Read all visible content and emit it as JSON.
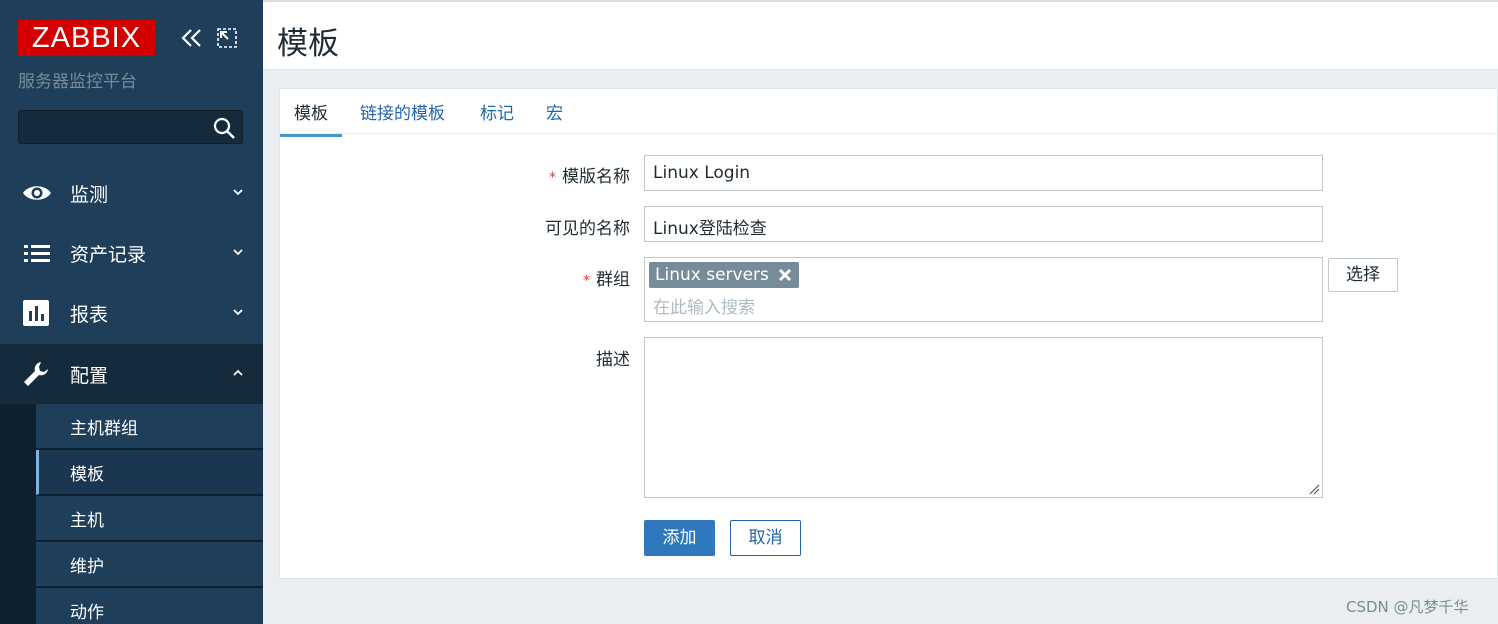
{
  "brand": {
    "logo_text": "ZABBIX",
    "subtitle": "服务器监控平台",
    "accent": "#d40000"
  },
  "sidebar": {
    "search_placeholder": "",
    "menu": [
      {
        "label": "监测",
        "icon": "eye-icon",
        "expanded": false
      },
      {
        "label": "资产记录",
        "icon": "list-icon",
        "expanded": false
      },
      {
        "label": "报表",
        "icon": "bar-chart-icon",
        "expanded": false
      },
      {
        "label": "配置",
        "icon": "wrench-icon",
        "expanded": true
      }
    ],
    "submenu": [
      {
        "label": "主机群组"
      },
      {
        "label": "模板",
        "selected": true
      },
      {
        "label": "主机"
      },
      {
        "label": "维护"
      },
      {
        "label": "动作"
      }
    ]
  },
  "header": {
    "title": "模板"
  },
  "tabs": [
    {
      "label": "模板",
      "active": true
    },
    {
      "label": "链接的模板"
    },
    {
      "label": "标记"
    },
    {
      "label": "宏"
    }
  ],
  "form": {
    "template_name": {
      "label": "模版名称",
      "required": true,
      "value": "Linux Login"
    },
    "visible_name": {
      "label": "可见的名称",
      "value": "Linux登陆检查"
    },
    "groups": {
      "label": "群组",
      "required": true,
      "chips": [
        "Linux servers"
      ],
      "placeholder": "在此输入搜索",
      "select_label": "选择"
    },
    "description": {
      "label": "描述",
      "value": ""
    },
    "add_label": "添加",
    "cancel_label": "取消"
  },
  "watermark": "CSDN @凡梦千华"
}
